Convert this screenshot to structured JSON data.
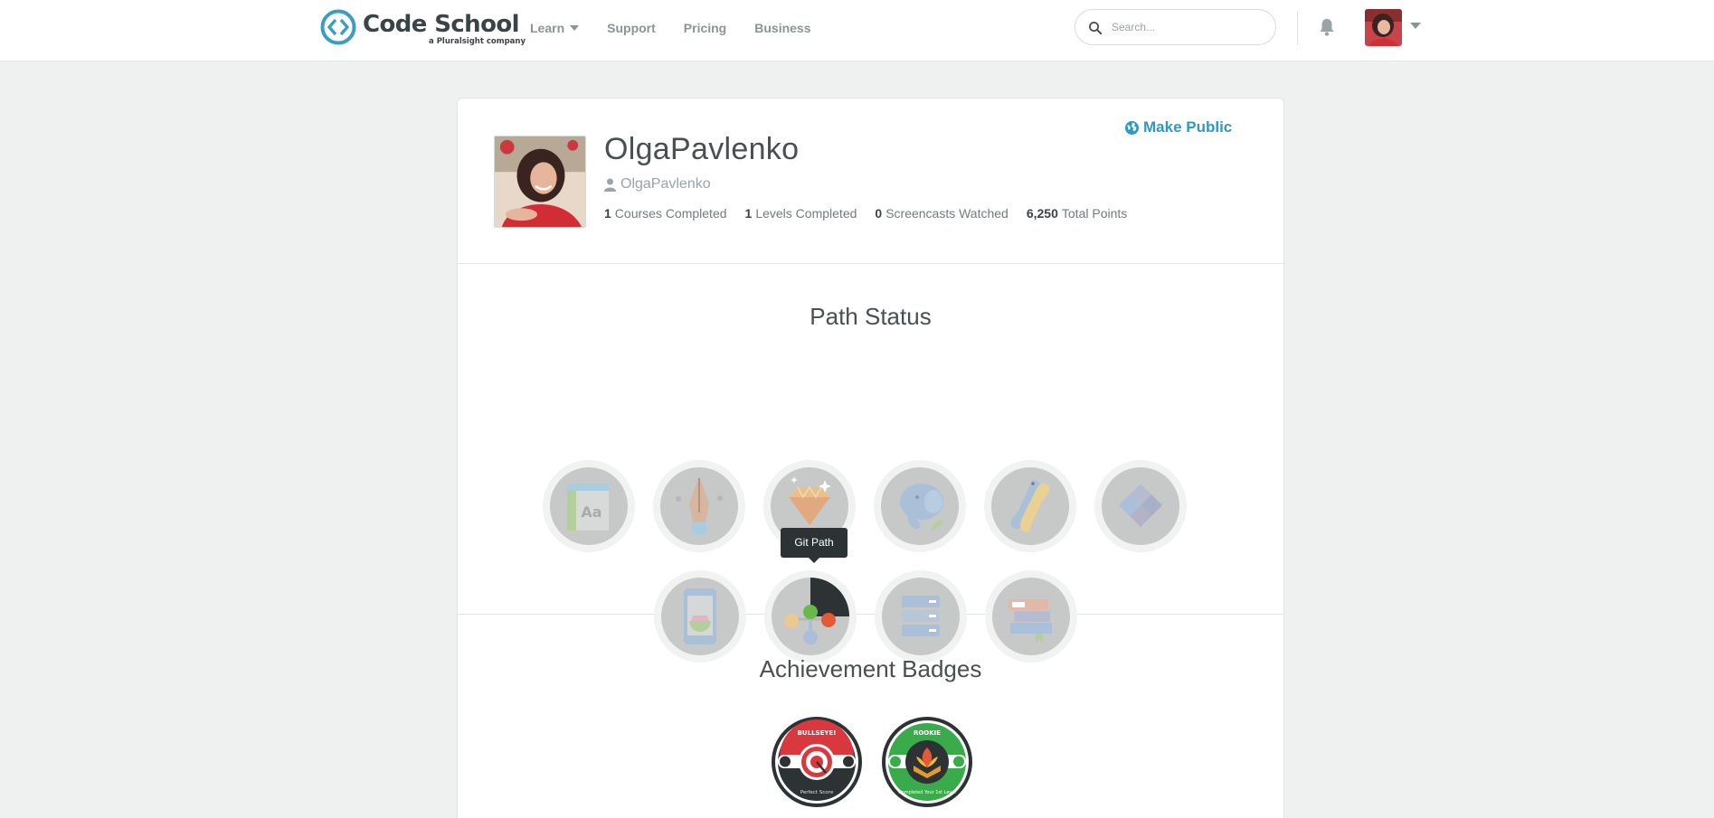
{
  "header": {
    "logo_title": "Code School",
    "logo_subtitle": "a Pluralsight company",
    "nav": [
      {
        "label": "Learn",
        "has_dropdown": true
      },
      {
        "label": "Support"
      },
      {
        "label": "Pricing"
      },
      {
        "label": "Business"
      }
    ],
    "search_placeholder": "Search..."
  },
  "profile": {
    "name": "OlgaPavlenko",
    "username": "OlgaPavlenko",
    "make_public_label": "Make Public",
    "stats": [
      {
        "value": "1",
        "label": "Courses Completed"
      },
      {
        "value": "1",
        "label": "Levels Completed"
      },
      {
        "value": "0",
        "label": "Screencasts Watched"
      },
      {
        "value": "6,250",
        "label": "Total Points"
      }
    ]
  },
  "path_status": {
    "title": "Path Status",
    "tooltip": "Git Path",
    "paths": [
      {
        "icon": "html-css-path-icon",
        "glyph": "Aa"
      },
      {
        "icon": "pen-path-icon"
      },
      {
        "icon": "ruby-gem-path-icon"
      },
      {
        "icon": "php-elephant-path-icon"
      },
      {
        "icon": "python-path-icon"
      },
      {
        "icon": "javascript-path-icon"
      },
      {
        "icon": "ios-path-icon"
      },
      {
        "icon": "git-path-icon",
        "progress": 0.25
      },
      {
        "icon": "database-path-icon"
      },
      {
        "icon": "books-path-icon"
      }
    ]
  },
  "achievements": {
    "title": "Achievement Badges",
    "badges": [
      {
        "name": "BULLSEYE!",
        "caption": "Perfect Score",
        "color": "#d9393e"
      },
      {
        "name": "ROOKIE",
        "caption": "Completed Your 1st Level",
        "color": "#3aab4b"
      }
    ]
  },
  "colors": {
    "accent": "#2f98c8",
    "background": "#eef1ef",
    "tooltip": "#2d3235"
  }
}
